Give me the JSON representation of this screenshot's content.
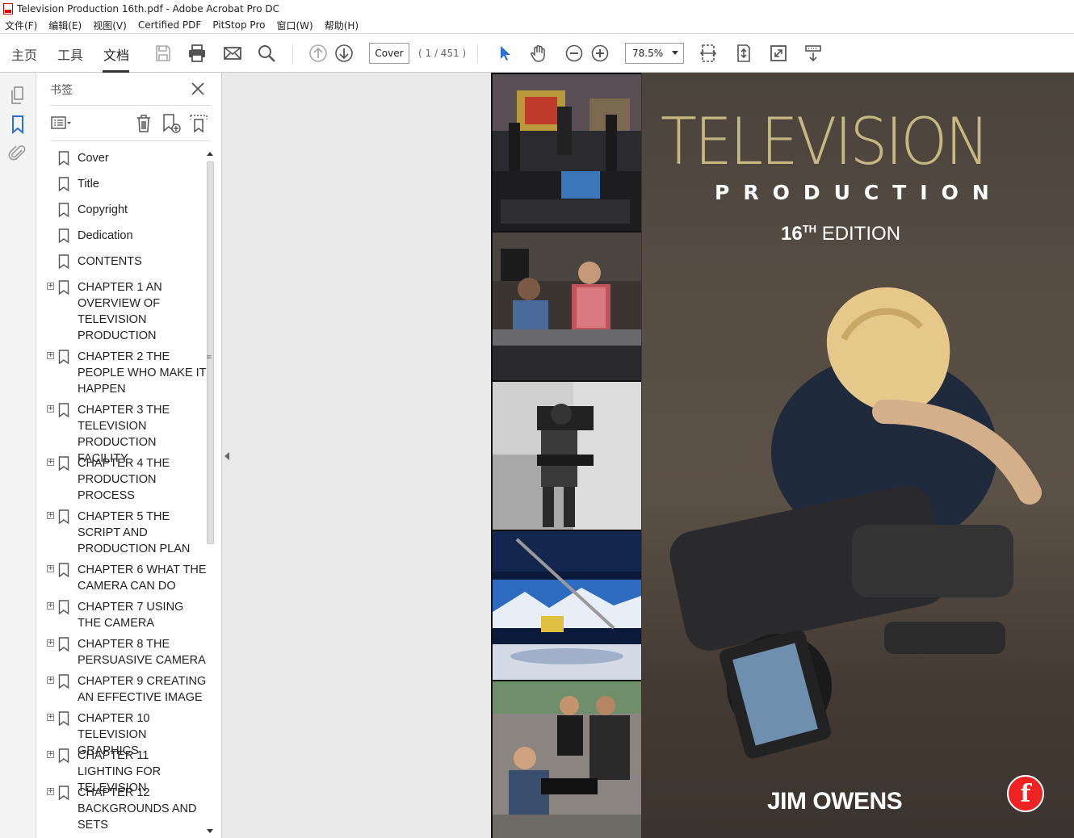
{
  "window": {
    "title": "Television Production 16th.pdf - Adobe Acrobat Pro DC"
  },
  "menu": [
    "文件(F)",
    "编辑(E)",
    "视图(V)",
    "Certified PDF",
    "PitStop Pro",
    "窗口(W)",
    "帮助(H)"
  ],
  "toolbar": {
    "tabs": [
      "主页",
      "工具",
      "文档"
    ],
    "active_tab": "文档",
    "page_input": "Cover",
    "page_count": "( 1 / 451 )",
    "zoom": "78.5%"
  },
  "panel": {
    "title": "书签",
    "bookmarks": [
      {
        "label": "Cover",
        "expandable": false
      },
      {
        "label": "Title",
        "expandable": false
      },
      {
        "label": "Copyright",
        "expandable": false
      },
      {
        "label": "Dedication",
        "expandable": false
      },
      {
        "label": "CONTENTS",
        "expandable": false
      },
      {
        "label": "CHAPTER 1 AN OVERVIEW OF TELEVISION PRODUCTION",
        "expandable": true
      },
      {
        "label": "CHAPTER 2 THE PEOPLE WHO MAKE IT HAPPEN",
        "expandable": true
      },
      {
        "label": "CHAPTER 3 THE TELEVISION PRODUCTION FACILITY",
        "expandable": true
      },
      {
        "label": "CHAPTER 4 THE PRODUCTION PROCESS",
        "expandable": true
      },
      {
        "label": "CHAPTER 5 THE SCRIPT AND PRODUCTION PLAN",
        "expandable": true
      },
      {
        "label": "CHAPTER 6 WHAT THE CAMERA CAN DO",
        "expandable": true
      },
      {
        "label": "CHAPTER 7 USING THE CAMERA",
        "expandable": true
      },
      {
        "label": "CHAPTER 8 THE PERSUASIVE CAMERA",
        "expandable": true
      },
      {
        "label": "CHAPTER 9 CREATING AN EFFECTIVE IMAGE",
        "expandable": true
      },
      {
        "label": "CHAPTER 10 TELEVISION GRAPHICS",
        "expandable": true
      },
      {
        "label": "CHAPTER 11 LIGHTING FOR TELEVISION",
        "expandable": true
      },
      {
        "label": "CHAPTER 12 BACKGROUNDS AND SETS",
        "expandable": true
      }
    ]
  },
  "cover": {
    "title": "TELEVISION",
    "subtitle": "PRODUCTION",
    "edition_num": "16",
    "edition_sup": "TH",
    "edition_word": "EDITION",
    "author": "JIM OWENS",
    "publisher_mark": "f",
    "accent_color": "#c7b882"
  }
}
